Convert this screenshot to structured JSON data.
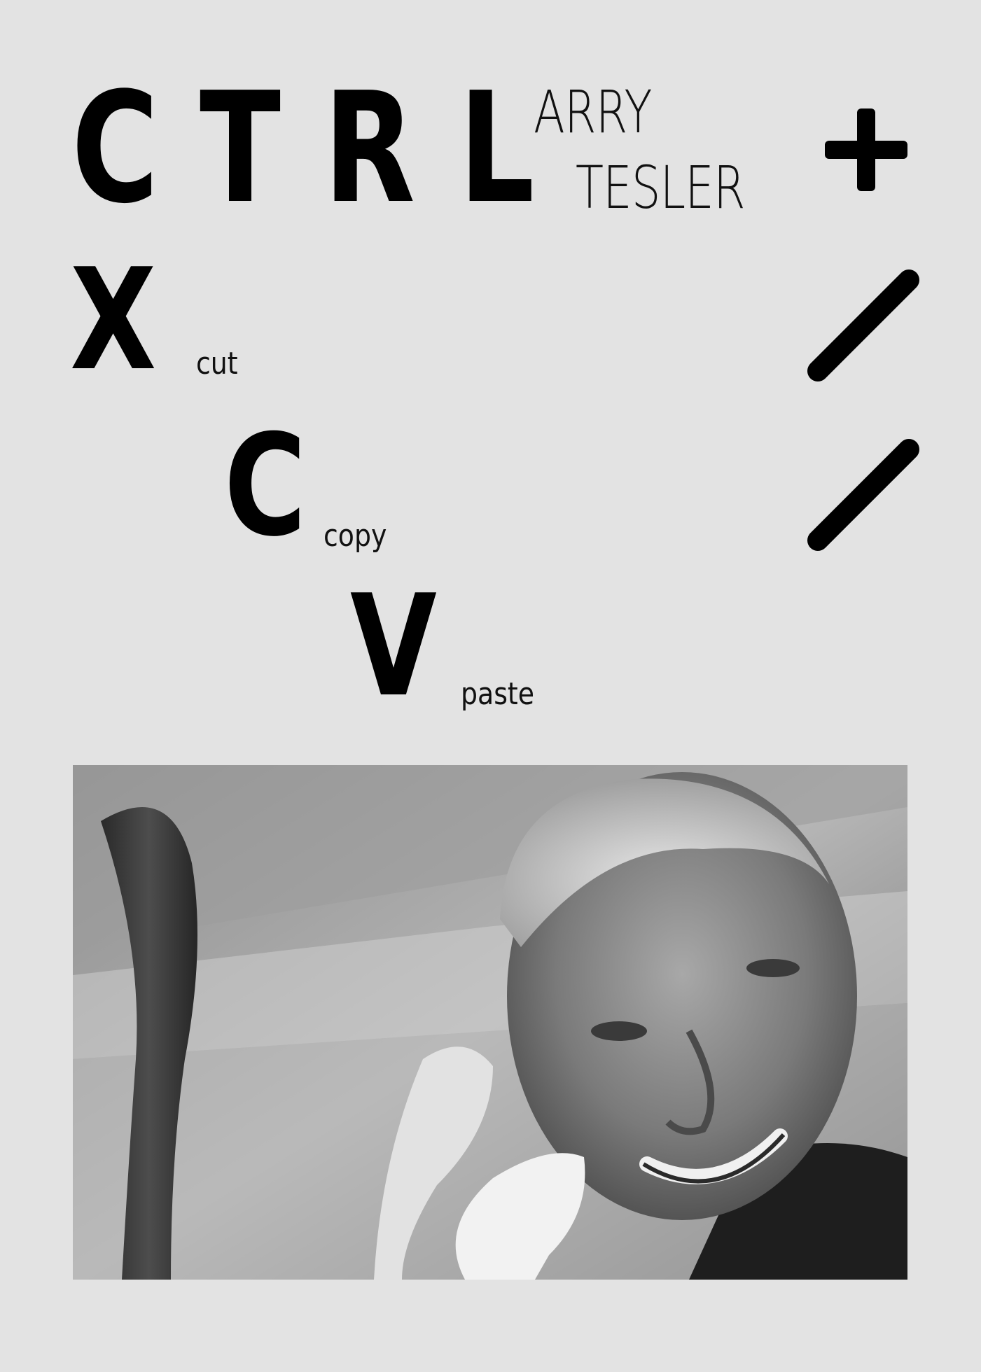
{
  "heading": {
    "ctrl_letters": [
      "C",
      "T",
      "R",
      "L"
    ],
    "name_line_1": "ARRY",
    "name_line_2": "TESLER",
    "plus_symbol": "+"
  },
  "shortcuts": [
    {
      "key": "X",
      "action": "cut"
    },
    {
      "key": "C",
      "action": "copy"
    },
    {
      "key": "V",
      "action": "paste"
    }
  ],
  "decor": {
    "slash_icons": [
      "slash-icon",
      "slash-icon"
    ]
  },
  "photo": {
    "subject": "portrait-photo",
    "style": "black-and-white"
  },
  "colors": {
    "background": "#e3e3e3",
    "ink": "#000000"
  }
}
